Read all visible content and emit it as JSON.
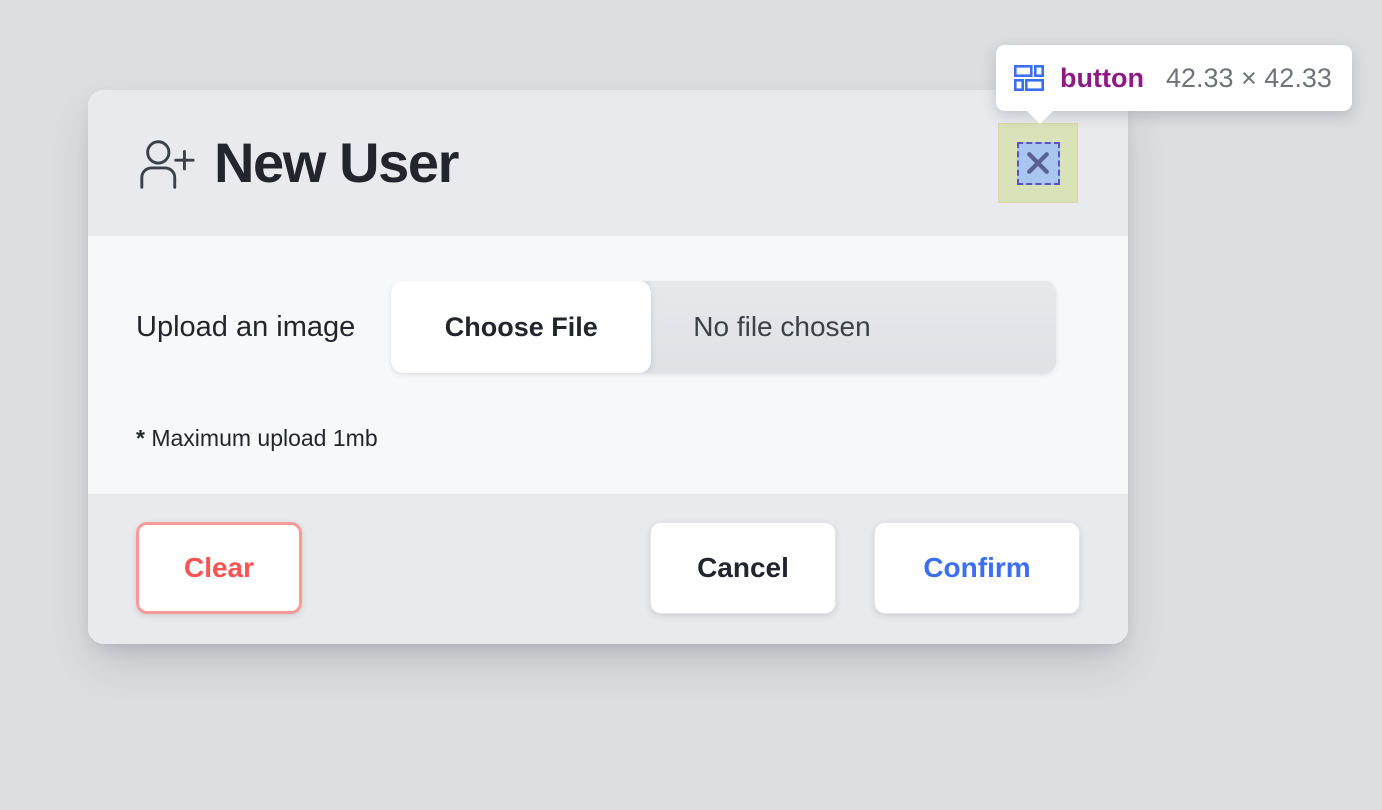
{
  "page": {
    "background_color": "#dcdde0"
  },
  "inspector": {
    "icon": "layout-grid-icon",
    "tag_name": "button",
    "dimensions": "42.33 × 42.33",
    "tag_color": "#8e1a84",
    "dimension_color": "#6f7378",
    "icon_color": "#3b6ef2",
    "highlight_fill": "#d0dd98",
    "selection_border": "#5b50c8",
    "selection_fill": "#a8c6ef"
  },
  "modal": {
    "header": {
      "icon": "user-plus-icon",
      "title": "New User",
      "close_icon": "close-icon",
      "background_color": "#e9eaee"
    },
    "body": {
      "upload_label": "Upload an image",
      "choose_file_label": "Choose File",
      "file_status": "No file chosen",
      "note_marker": "*",
      "note_text": "Maximum upload 1mb",
      "background_color": "#f7f8fa"
    },
    "footer": {
      "clear_label": "Clear",
      "cancel_label": "Cancel",
      "confirm_label": "Confirm",
      "clear_color": "#fb5252",
      "confirm_color": "#3b6ef2",
      "background_color": "#e9eaee"
    }
  }
}
